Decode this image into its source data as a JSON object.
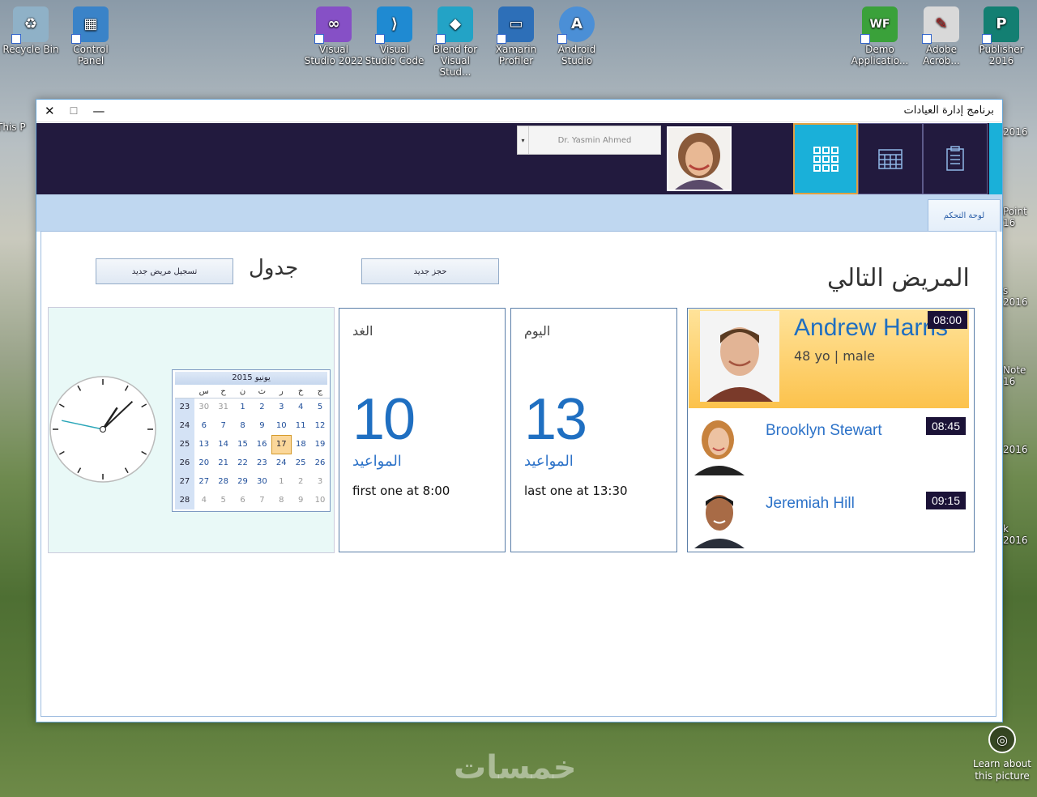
{
  "desktop": {
    "icons": [
      {
        "label": "Recycle Bin",
        "color": "#8fb1c7"
      },
      {
        "label": "Control Panel",
        "color": "#3a83c8"
      },
      {
        "label": "Visual Studio 2022",
        "color": "#8650c6"
      },
      {
        "label": "Visual Studio Code",
        "color": "#1f8ad2"
      },
      {
        "label": "Blend for Visual Stud...",
        "color": "#23a3c6"
      },
      {
        "label": "Xamarin Profiler",
        "color": "#2d6fb8"
      },
      {
        "label": "Android Studio",
        "color": "#4b8fd6"
      },
      {
        "label": "Demo Applicatio...",
        "color": "#3aa13a"
      },
      {
        "label": "Adobe Acrob...",
        "color": "#d9d9d9"
      },
      {
        "label": "Publisher 2016",
        "color": "#137f72"
      }
    ],
    "partial_icons": [
      "This P",
      "2016",
      "Point 16",
      "s 2016",
      "Note 16",
      "2016",
      "k 2016"
    ],
    "learn_label": "Learn about this picture",
    "watermark": "خمسات"
  },
  "window": {
    "title": "برنامج إدارة العيادات",
    "controls": {
      "close": "✕",
      "maximize": "☐",
      "minimize": "—"
    }
  },
  "topbar": {
    "doctor_name": "Dr. Yasmin Ahmed",
    "nav": [
      {
        "name": "dashboard",
        "icon": "grid-icon"
      },
      {
        "name": "calendar",
        "icon": "calendar-icon"
      },
      {
        "name": "clipboard",
        "icon": "clipboard-icon"
      }
    ]
  },
  "tabs": {
    "active": "لوحة التحكم"
  },
  "dashboard": {
    "new_patient_button": "تسجيل مريض جديد",
    "schedule_title": "جدول",
    "new_booking_button": "حجز جديد",
    "next_patient_title": "المريض التالي",
    "tomorrow": {
      "label": "الغد",
      "count": "10",
      "sub": "المواعيد",
      "note": "first one at 8:00"
    },
    "today": {
      "label": "اليوم",
      "count": "13",
      "sub": "المواعيد",
      "note": "last one at 13:30"
    },
    "patients": [
      {
        "name": "Andrew Harris",
        "info": "48 yo | male",
        "time": "08:00"
      },
      {
        "name": "Brooklyn Stewart",
        "time": "08:45"
      },
      {
        "name": "Jeremiah Hill",
        "time": "09:15"
      }
    ],
    "clock": {
      "hour": 1,
      "minute": 7,
      "second": 47
    },
    "calendar": {
      "header": "يونيو 2015",
      "day_names": [
        "س",
        "ح",
        "ن",
        "ث",
        "ر",
        "خ",
        "ج"
      ],
      "weeks": [
        {
          "wk": "23",
          "days": [
            "30",
            "31",
            "1",
            "2",
            "3",
            "4",
            "5"
          ]
        },
        {
          "wk": "24",
          "days": [
            "6",
            "7",
            "8",
            "9",
            "10",
            "11",
            "12"
          ]
        },
        {
          "wk": "25",
          "days": [
            "13",
            "14",
            "15",
            "16",
            "17",
            "18",
            "19"
          ]
        },
        {
          "wk": "26",
          "days": [
            "20",
            "21",
            "22",
            "23",
            "24",
            "25",
            "26"
          ]
        },
        {
          "wk": "27",
          "days": [
            "27",
            "28",
            "29",
            "30",
            "1",
            "2",
            "3"
          ]
        },
        {
          "wk": "28",
          "days": [
            "4",
            "5",
            "6",
            "7",
            "8",
            "9",
            "10"
          ]
        }
      ],
      "today": "17"
    }
  }
}
